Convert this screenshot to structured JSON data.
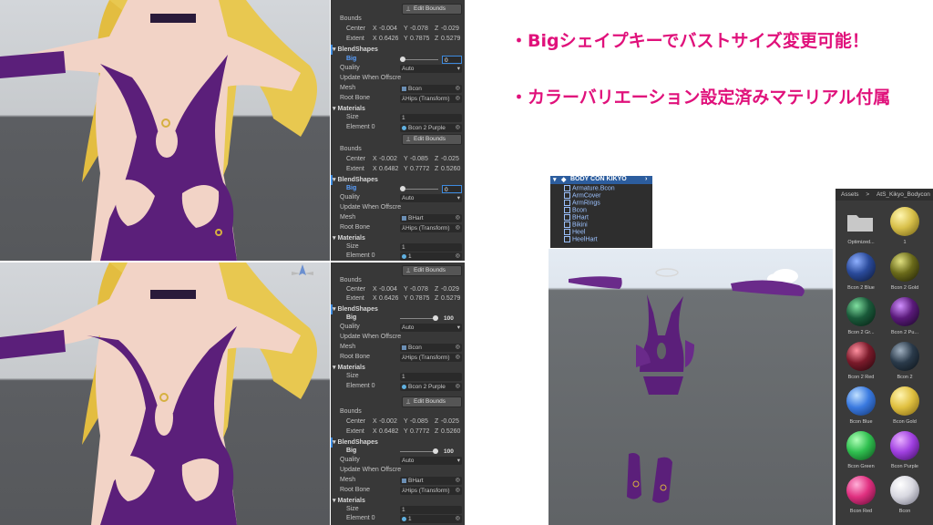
{
  "headline": {
    "line1": "・Bigシェイプキーでバストサイズ変更可能！",
    "line2": "・カラーバリエーション設定済みマテリアル付属"
  },
  "inspector_panels": [
    {
      "edit_bounds_1": "Edit Bounds",
      "bounds_label": "Bounds",
      "center_label": "Center",
      "center": {
        "x": "-0.004",
        "y": "-0.078",
        "z": "-0.029"
      },
      "extent_label": "Extent",
      "extent": {
        "x": "0.6426",
        "y": "0.7875",
        "z": "0.5279"
      },
      "blendshapes_label": "BlendShapes",
      "big_label": "Big",
      "big_value": "0",
      "quality_label": "Quality",
      "quality_value": "Auto",
      "update_label": "Update When Offscre",
      "mesh_label": "Mesh",
      "mesh_value": "Bcon",
      "root_label": "Root Bone",
      "root_value": "Hips (Transform)",
      "materials_label": "Materials",
      "size_label": "Size",
      "size_value": "1",
      "element_label": "Element 0",
      "element_value": "Bcon 2 Purple",
      "edit_bounds_2": "Edit Bounds",
      "bounds2_label": "Bounds",
      "center2_label": "Center",
      "center2": {
        "x": "-0.002",
        "y": "-0.085",
        "z": "-0.025"
      },
      "extent2_label": "Extent",
      "extent2": {
        "x": "0.6482",
        "y": "0.7772",
        "z": "0.5260"
      },
      "blendshapes2_label": "BlendShapes",
      "big2_label": "Big",
      "big2_value": "0",
      "quality2_label": "Quality",
      "quality2_value": "Auto",
      "update2_label": "Update When Offscre",
      "mesh2_label": "Mesh",
      "mesh2_value": "BHart",
      "root2_label": "Root Bone",
      "root2_value": "Hips (Transform)",
      "materials2_label": "Materials",
      "size2_label": "Size",
      "size2_value": "1",
      "element2_label": "Element 0",
      "element2_value": "1"
    },
    {
      "edit_bounds_1": "Edit Bounds",
      "bounds_label": "Bounds",
      "center_label": "Center",
      "center": {
        "x": "-0.004",
        "y": "-0.078",
        "z": "-0.029"
      },
      "extent_label": "Extent",
      "extent": {
        "x": "0.6426",
        "y": "0.7875",
        "z": "0.5279"
      },
      "blendshapes_label": "BlendShapes",
      "big_label": "Big",
      "big_value": "100",
      "quality_label": "Quality",
      "quality_value": "Auto",
      "update_label": "Update When Offscre",
      "mesh_label": "Mesh",
      "mesh_value": "Bcon",
      "root_label": "Root Bone",
      "root_value": "Hips (Transform)",
      "materials_label": "Materials",
      "size_label": "Size",
      "size_value": "1",
      "element_label": "Element 0",
      "element_value": "Bcon 2 Purple",
      "edit_bounds_2": "Edit Bounds",
      "bounds2_label": "Bounds",
      "center2_label": "Center",
      "center2": {
        "x": "-0.002",
        "y": "-0.085",
        "z": "-0.025"
      },
      "extent2_label": "Extent",
      "extent2": {
        "x": "0.6482",
        "y": "0.7772",
        "z": "0.5260"
      },
      "blendshapes2_label": "BlendShapes",
      "big2_label": "Big",
      "big2_value": "100",
      "quality2_label": "Quality",
      "quality2_value": "Auto",
      "update2_label": "Update When Offscre",
      "mesh2_label": "Mesh",
      "mesh2_value": "BHart",
      "root2_label": "Root Bone",
      "root2_value": "Hips (Transform)",
      "materials2_label": "Materials",
      "size2_label": "Size",
      "size2_value": "1",
      "element2_label": "Element 0",
      "element2_value": "1"
    }
  ],
  "axis_letters": {
    "x": "X",
    "y": "Y",
    "z": "Z"
  },
  "hierarchy": {
    "root": "BODY CON KIKYO",
    "items": [
      "Armature.Bcon",
      "ArmCover",
      "ArmRings",
      "Bcon",
      "BHart",
      "Bikini",
      "Heel",
      "HeelHart"
    ]
  },
  "assets": {
    "breadcrumb_root": "Assets",
    "breadcrumb_sep": ">",
    "breadcrumb_folder": "AtS_Kikyo_Bodycon",
    "tiles": [
      {
        "label": "Optimized...",
        "color": "folder"
      },
      {
        "label": "1",
        "color": "#d8c04a"
      },
      {
        "label": "Bcon 2 Blue",
        "color": "#2a4a9a"
      },
      {
        "label": "Bcon 2 Gold",
        "color": "#6a6a1a"
      },
      {
        "label": "Bcon 2 Gr...",
        "color": "#1a5a3a"
      },
      {
        "label": "Bcon 2 Pu...",
        "color": "#5a1a7a"
      },
      {
        "label": "Bcon 2 Red",
        "color": "#7a1a2a"
      },
      {
        "label": "Bcon 2",
        "color": "#2a3a4a"
      },
      {
        "label": "Bcon Blue",
        "color": "#3a7ae0"
      },
      {
        "label": "Bcon Gold",
        "color": "#e0c040"
      },
      {
        "label": "Bcon Green",
        "color": "#30c050"
      },
      {
        "label": "Bcon Purple",
        "color": "#a040e0"
      },
      {
        "label": "Bcon Red",
        "color": "#e03080"
      },
      {
        "label": "Bcon",
        "color": "#d8d8e0"
      }
    ]
  },
  "colors": {
    "accent_pink": "#e0117b",
    "outfit_purple": "#5b1f7a",
    "hair_blonde": "#e8c850",
    "unity_panel": "#383838",
    "selection_blue": "#2c5d9e"
  },
  "icons": [
    "edit-bounds-icon",
    "target-icon",
    "dropdown-icon",
    "mesh-icon",
    "transform-icon",
    "material-icon",
    "prefab-icon",
    "folder-icon",
    "scene-gizmo-icon"
  ]
}
